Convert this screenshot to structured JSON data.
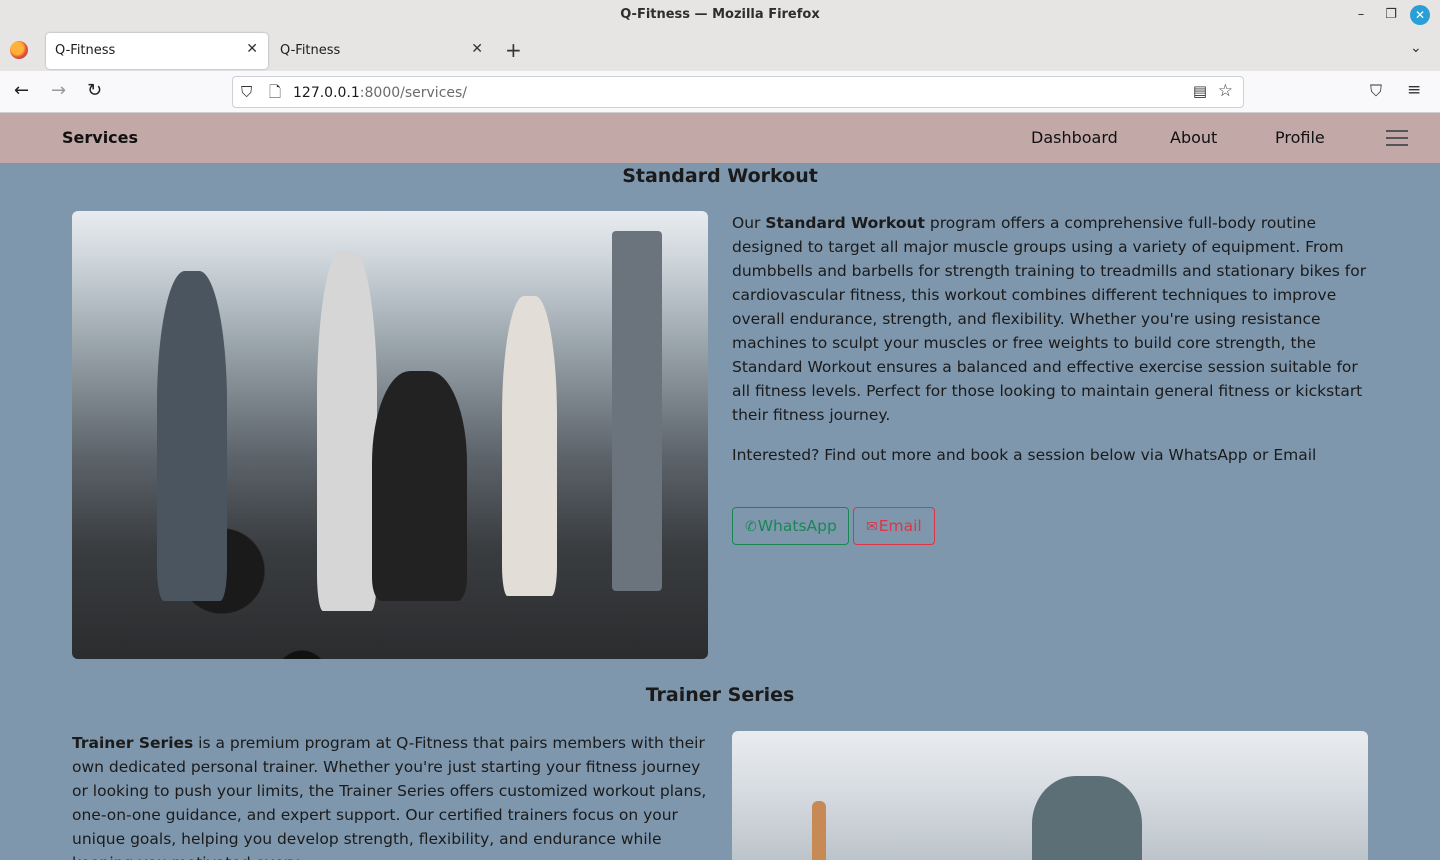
{
  "window": {
    "title": "Q-Fitness — Mozilla Firefox"
  },
  "tabs": [
    {
      "label": "Q-Fitness",
      "active": true
    },
    {
      "label": "Q-Fitness",
      "active": false
    }
  ],
  "address_bar": {
    "host": "127.0.0.1",
    "path": ":8000/services/"
  },
  "site_nav": {
    "brand": "Services",
    "links": [
      "Dashboard",
      "About",
      "Profile"
    ]
  },
  "sections": [
    {
      "title": "Standard Workout",
      "intro": "Our ",
      "bold": "Standard Workout",
      "body": " program offers a comprehensive full-body routine designed to target all major muscle groups using a variety of equipment. From dumbbells and barbells for strength training to treadmills and stationary bikes for cardiovascular fitness, this workout combines different techniques to improve overall endurance, strength, and flexibility. Whether you're using resistance machines to sculpt your muscles or free weights to build core strength, the Standard Workout ensures a balanced and effective exercise session suitable for all fitness levels. Perfect for those looking to maintain general fitness or kickstart their fitness journey.",
      "cta": "Interested? Find out more and book a session below via WhatsApp or Email",
      "buttons": {
        "whatsapp": "WhatsApp",
        "email": "Email"
      }
    },
    {
      "title": "Trainer Series",
      "bold": "Trainer Series",
      "body": " is a premium program at Q-Fitness that pairs members with their own dedicated personal trainer. Whether you're just starting your fitness journey or looking to push your limits, the Trainer Series offers customized workout plans, one-on-one guidance, and expert support. Our certified trainers focus on your unique goals, helping you develop strength, flexibility, and endurance while keeping you motivated every"
    }
  ],
  "colors": {
    "page_bg": "#7e97ad",
    "navbar_bg": "#c3a8a8",
    "whatsapp": "#198754",
    "email": "#dc3545"
  }
}
